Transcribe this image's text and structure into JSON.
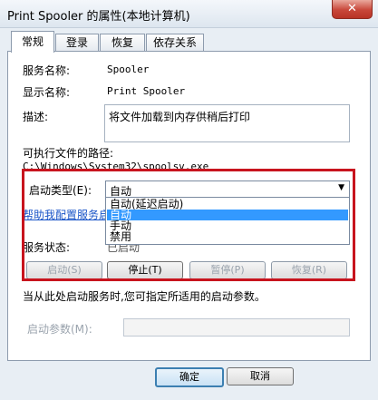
{
  "window": {
    "title": "Print Spooler 的属性(本地计算机)",
    "close_glyph": "✕"
  },
  "tabs": [
    {
      "label": "常规",
      "active": true
    },
    {
      "label": "登录"
    },
    {
      "label": "恢复"
    },
    {
      "label": "依存关系"
    }
  ],
  "general": {
    "service_name_label": "服务名称:",
    "service_name_value": "Spooler",
    "display_name_label": "显示名称:",
    "display_name_value": "Print Spooler",
    "description_label": "描述:",
    "description_value": "将文件加载到内存供稍后打印",
    "path_label": "可执行文件的路径:",
    "path_value": "C:\\Windows\\System32\\spoolsv.exe",
    "startup_type_label": "启动类型(E):",
    "startup_type_selected": "自动",
    "startup_options": [
      "自动(延迟启动)",
      "自动",
      "手动",
      "禁用"
    ],
    "startup_highlighted_index": 1,
    "help_link": "帮助我配置服务启动",
    "status_label": "服务状态:",
    "status_value": "已启动",
    "start_button": "启动(S)",
    "stop_button": "停止(T)",
    "pause_button": "暂停(P)",
    "resume_button": "恢复(R)",
    "hint_text": "当从此处启动服务时,您可指定所适用的启动参数。",
    "params_label": "启动参数(M):",
    "params_value": ""
  },
  "footer": {
    "ok_button": "确定",
    "cancel_button": "取消"
  },
  "colors": {
    "annotation": "#c8141e",
    "highlight": "#3399ff",
    "link": "#1a55c8"
  }
}
